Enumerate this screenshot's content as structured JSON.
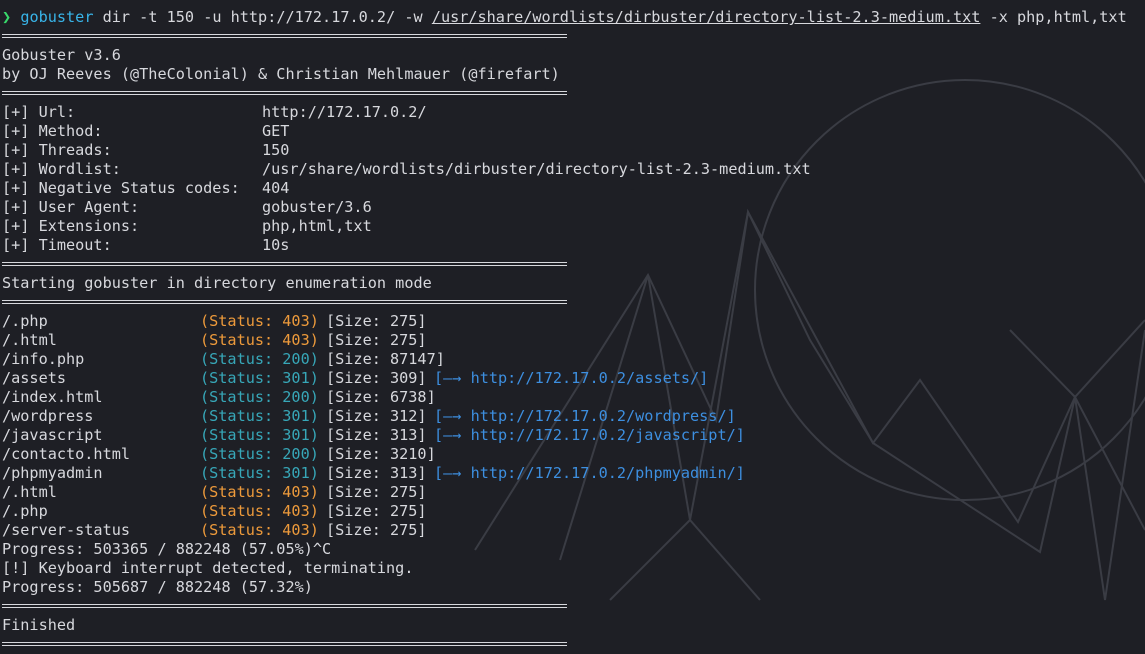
{
  "window": {
    "background": "#1e1f25",
    "foreground": "#d7d8dd"
  },
  "colors": {
    "prompt_arrow": "#38d86b",
    "command": "#38b4e8",
    "status_403": "#ed9a3b",
    "status_2xx_3xx": "#37a7b8",
    "redirect": "#3d8fe0"
  },
  "prompt": {
    "symbol": "❯",
    "command": "gobuster",
    "args_before": " dir -t 150 -u http://172.17.0.2/ -w ",
    "wordlist": "/usr/share/wordlists/dirbuster/directory-list-2.3-medium.txt",
    "args_after": " -x php,html,txt"
  },
  "banner": {
    "version": "Gobuster v3.6",
    "authors": "by OJ Reeves (@TheColonial) & Christian Mehlmauer (@firefart)"
  },
  "config": [
    {
      "key": "[+] Url:",
      "value": "http://172.17.0.2/"
    },
    {
      "key": "[+] Method:",
      "value": "GET"
    },
    {
      "key": "[+] Threads:",
      "value": "150"
    },
    {
      "key": "[+] Wordlist:",
      "value": "/usr/share/wordlists/dirbuster/directory-list-2.3-medium.txt"
    },
    {
      "key": "[+] Negative Status codes:",
      "value": "404"
    },
    {
      "key": "[+] User Agent:",
      "value": "gobuster/3.6"
    },
    {
      "key": "[+] Extensions:",
      "value": "php,html,txt"
    },
    {
      "key": "[+] Timeout:",
      "value": "10s"
    }
  ],
  "mode_message": "Starting gobuster in directory enumeration mode",
  "results": [
    {
      "path": "/.php",
      "status": "(Status: 403)",
      "code": 403,
      "size": "[Size: 275]",
      "redirect": ""
    },
    {
      "path": "/.html",
      "status": "(Status: 403)",
      "code": 403,
      "size": "[Size: 275]",
      "redirect": ""
    },
    {
      "path": "/info.php",
      "status": "(Status: 200)",
      "code": 200,
      "size": "[Size: 87147]",
      "redirect": ""
    },
    {
      "path": "/assets",
      "status": "(Status: 301)",
      "code": 301,
      "size": "[Size: 309]",
      "redirect": "[—→ http://172.17.0.2/assets/]"
    },
    {
      "path": "/index.html",
      "status": "(Status: 200)",
      "code": 200,
      "size": "[Size: 6738]",
      "redirect": ""
    },
    {
      "path": "/wordpress",
      "status": "(Status: 301)",
      "code": 301,
      "size": "[Size: 312]",
      "redirect": "[—→ http://172.17.0.2/wordpress/]"
    },
    {
      "path": "/javascript",
      "status": "(Status: 301)",
      "code": 301,
      "size": "[Size: 313]",
      "redirect": "[—→ http://172.17.0.2/javascript/]"
    },
    {
      "path": "/contacto.html",
      "status": "(Status: 200)",
      "code": 200,
      "size": "[Size: 3210]",
      "redirect": ""
    },
    {
      "path": "/phpmyadmin",
      "status": "(Status: 301)",
      "code": 301,
      "size": "[Size: 313]",
      "redirect": "[—→ http://172.17.0.2/phpmyadmin/]"
    },
    {
      "path": "/.html",
      "status": "(Status: 403)",
      "code": 403,
      "size": "[Size: 275]",
      "redirect": ""
    },
    {
      "path": "/.php",
      "status": "(Status: 403)",
      "code": 403,
      "size": "[Size: 275]",
      "redirect": ""
    },
    {
      "path": "/server-status",
      "status": "(Status: 403)",
      "code": 403,
      "size": "[Size: 275]",
      "redirect": ""
    }
  ],
  "progress_1": "Progress: 503365 / 882248 (57.05%)^C",
  "interrupt": "[!] Keyboard interrupt detected, terminating.",
  "progress_2": "Progress: 505687 / 882248 (57.32%)",
  "finished": "Finished"
}
